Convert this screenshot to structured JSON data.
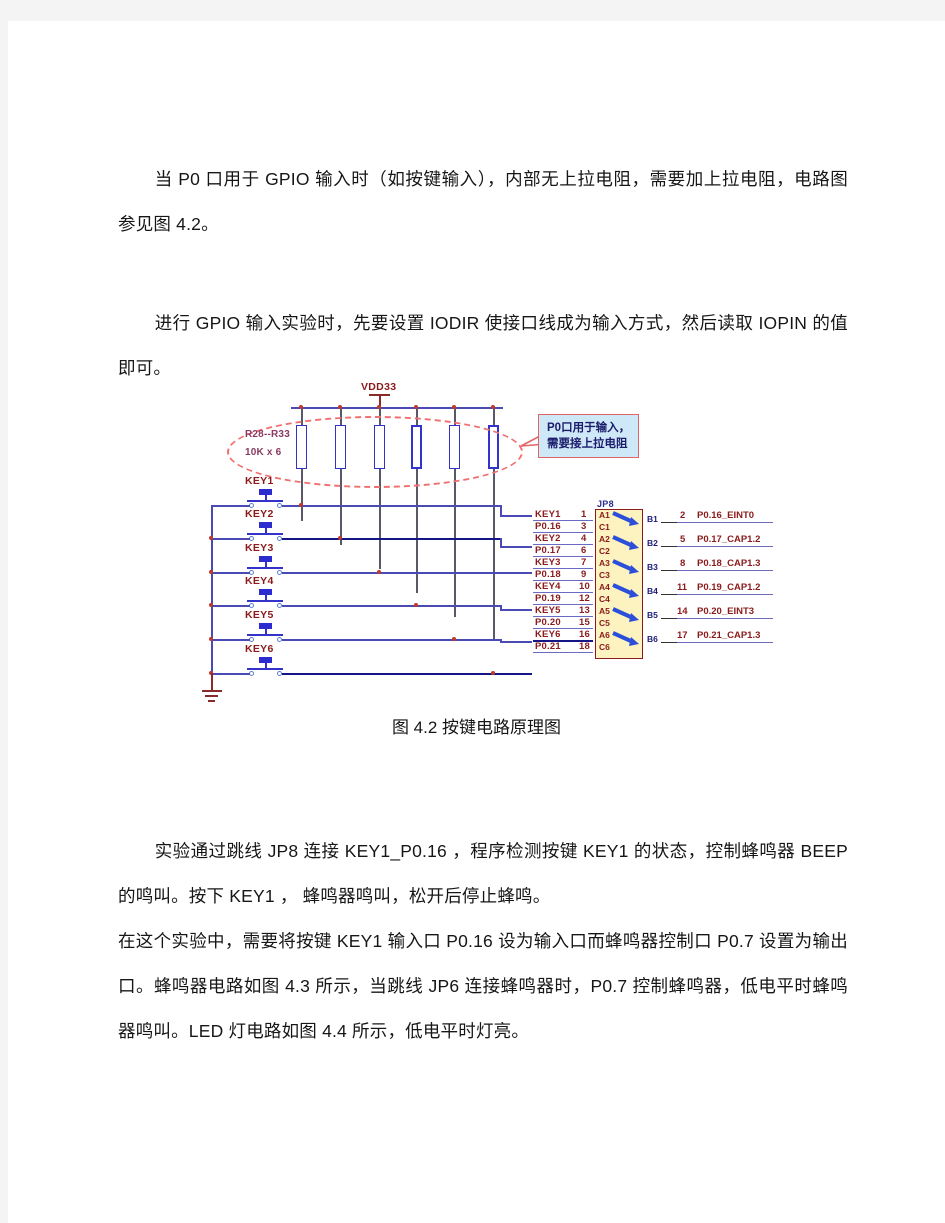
{
  "document": {
    "paragraphs": [
      "当 P0  口用于 GPIO 输入时（如按键输入），内部无上拉电阻，需要加上拉电阻，电路图参见图 4.2。",
      "进行 GPIO  输入实验时，先要设置 IODIR  使接口线成为输入方式，然后读取 IOPIN  的值即可。",
      "实验通过跳线 JP8  连接 KEY1_P0.16 ，程序检测按键 KEY1  的状态，控制蜂鸣器 BEEP  的鸣叫。按下 KEY1 ， 蜂鸣器鸣叫，松开后停止蜂鸣。",
      "在这个实验中，需要将按键 KEY1  输入口 P0.16  设为输入口而蜂鸣器控制口 P0.7  设置为输出口。蜂鸣器电路如图 4.3  所示，当跳线 JP6  连接蜂鸣器时，P0.7  控制蜂鸣器，低电平时蜂鸣器鸣叫。LED 灯电路如图 4.4 所示，低电平时灯亮。"
    ],
    "figure_caption": "图 4.2 按键电路原理图"
  },
  "figure": {
    "power_label": "VDD33",
    "resistor_label_line1": "R28--R33",
    "resistor_label_line2": "10K x 6",
    "callout_line1": "P0口用于输入，",
    "callout_line2": "需要接上拉电阻",
    "connector_name": "JP8",
    "switches": [
      "KEY1",
      "KEY2",
      "KEY3",
      "KEY4",
      "KEY5",
      "KEY6"
    ],
    "left_nets": [
      {
        "name": "KEY1",
        "pin": "1"
      },
      {
        "name": "P0.16",
        "pin": "3"
      },
      {
        "name": "KEY2",
        "pin": "4"
      },
      {
        "name": "P0.17",
        "pin": "6"
      },
      {
        "name": "KEY3",
        "pin": "7"
      },
      {
        "name": "P0.18",
        "pin": "9"
      },
      {
        "name": "KEY4",
        "pin": "10"
      },
      {
        "name": "P0.19",
        "pin": "12"
      },
      {
        "name": "KEY5",
        "pin": "13"
      },
      {
        "name": "P0.20",
        "pin": "15"
      },
      {
        "name": "KEY6",
        "pin": "16"
      },
      {
        "name": "P0.21",
        "pin": "18"
      }
    ],
    "connector_pins_a": [
      "A1",
      "C1",
      "A2",
      "C2",
      "A3",
      "C3",
      "A4",
      "C4",
      "A5",
      "C5",
      "A6",
      "C6"
    ],
    "connector_pins_b": [
      "B1",
      "B2",
      "B3",
      "B4",
      "B5",
      "B6"
    ],
    "right_nets": [
      {
        "pin": "2",
        "signal": "P0.16_EINT0"
      },
      {
        "pin": "5",
        "signal": "P0.17_CAP1.2"
      },
      {
        "pin": "8",
        "signal": "P0.18_CAP1.3"
      },
      {
        "pin": "11",
        "signal": "P0.19_CAP1.2"
      },
      {
        "pin": "14",
        "signal": "P0.20_EINT3"
      },
      {
        "pin": "17",
        "signal": "P0.21_CAP1.3"
      }
    ]
  },
  "colors": {
    "wire": "#4a4ab4",
    "highlight": "#f07070",
    "callout_bg": "#cfe8f7",
    "connector_bg": "#fdf3c0",
    "label_red": "#8b1a1a"
  }
}
